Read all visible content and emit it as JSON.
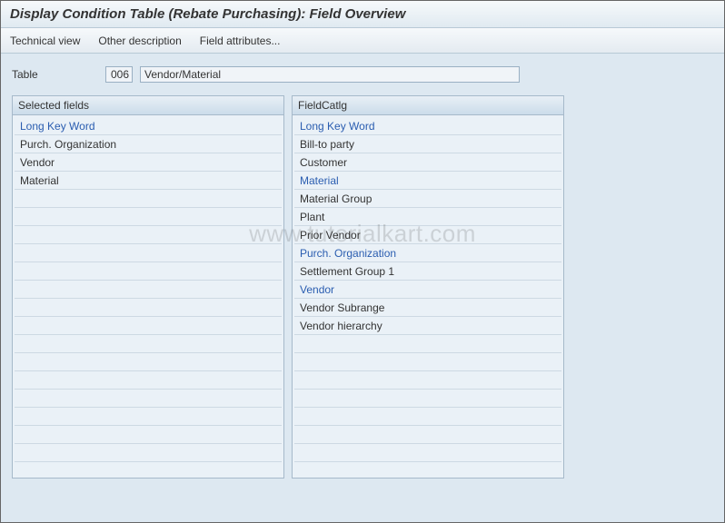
{
  "title": "Display Condition Table (Rebate Purchasing): Field Overview",
  "menu": {
    "technical_view": "Technical view",
    "other_description": "Other description",
    "field_attributes": "Field attributes..."
  },
  "table": {
    "label": "Table",
    "code": "006",
    "description": "Vendor/Material"
  },
  "panels": {
    "selected": {
      "title": "Selected fields",
      "header": "Long Key Word",
      "rows": [
        {
          "text": "Purch. Organization",
          "highlight": false
        },
        {
          "text": "Vendor",
          "highlight": false
        },
        {
          "text": "Material",
          "highlight": false
        }
      ],
      "empty_rows": 15
    },
    "catalog": {
      "title": "FieldCatlg",
      "header": "Long Key Word",
      "rows": [
        {
          "text": "Bill-to party",
          "highlight": false
        },
        {
          "text": "Customer",
          "highlight": false
        },
        {
          "text": "Material",
          "highlight": true
        },
        {
          "text": "Material Group",
          "highlight": false
        },
        {
          "text": "Plant",
          "highlight": false
        },
        {
          "text": "Prior Vendor",
          "highlight": false
        },
        {
          "text": "Purch. Organization",
          "highlight": true
        },
        {
          "text": "Settlement Group 1",
          "highlight": false
        },
        {
          "text": "Vendor",
          "highlight": true
        },
        {
          "text": "Vendor Subrange",
          "highlight": false
        },
        {
          "text": "Vendor hierarchy",
          "highlight": false
        }
      ],
      "empty_rows": 7
    }
  },
  "watermark": "www.tutorialkart.com"
}
